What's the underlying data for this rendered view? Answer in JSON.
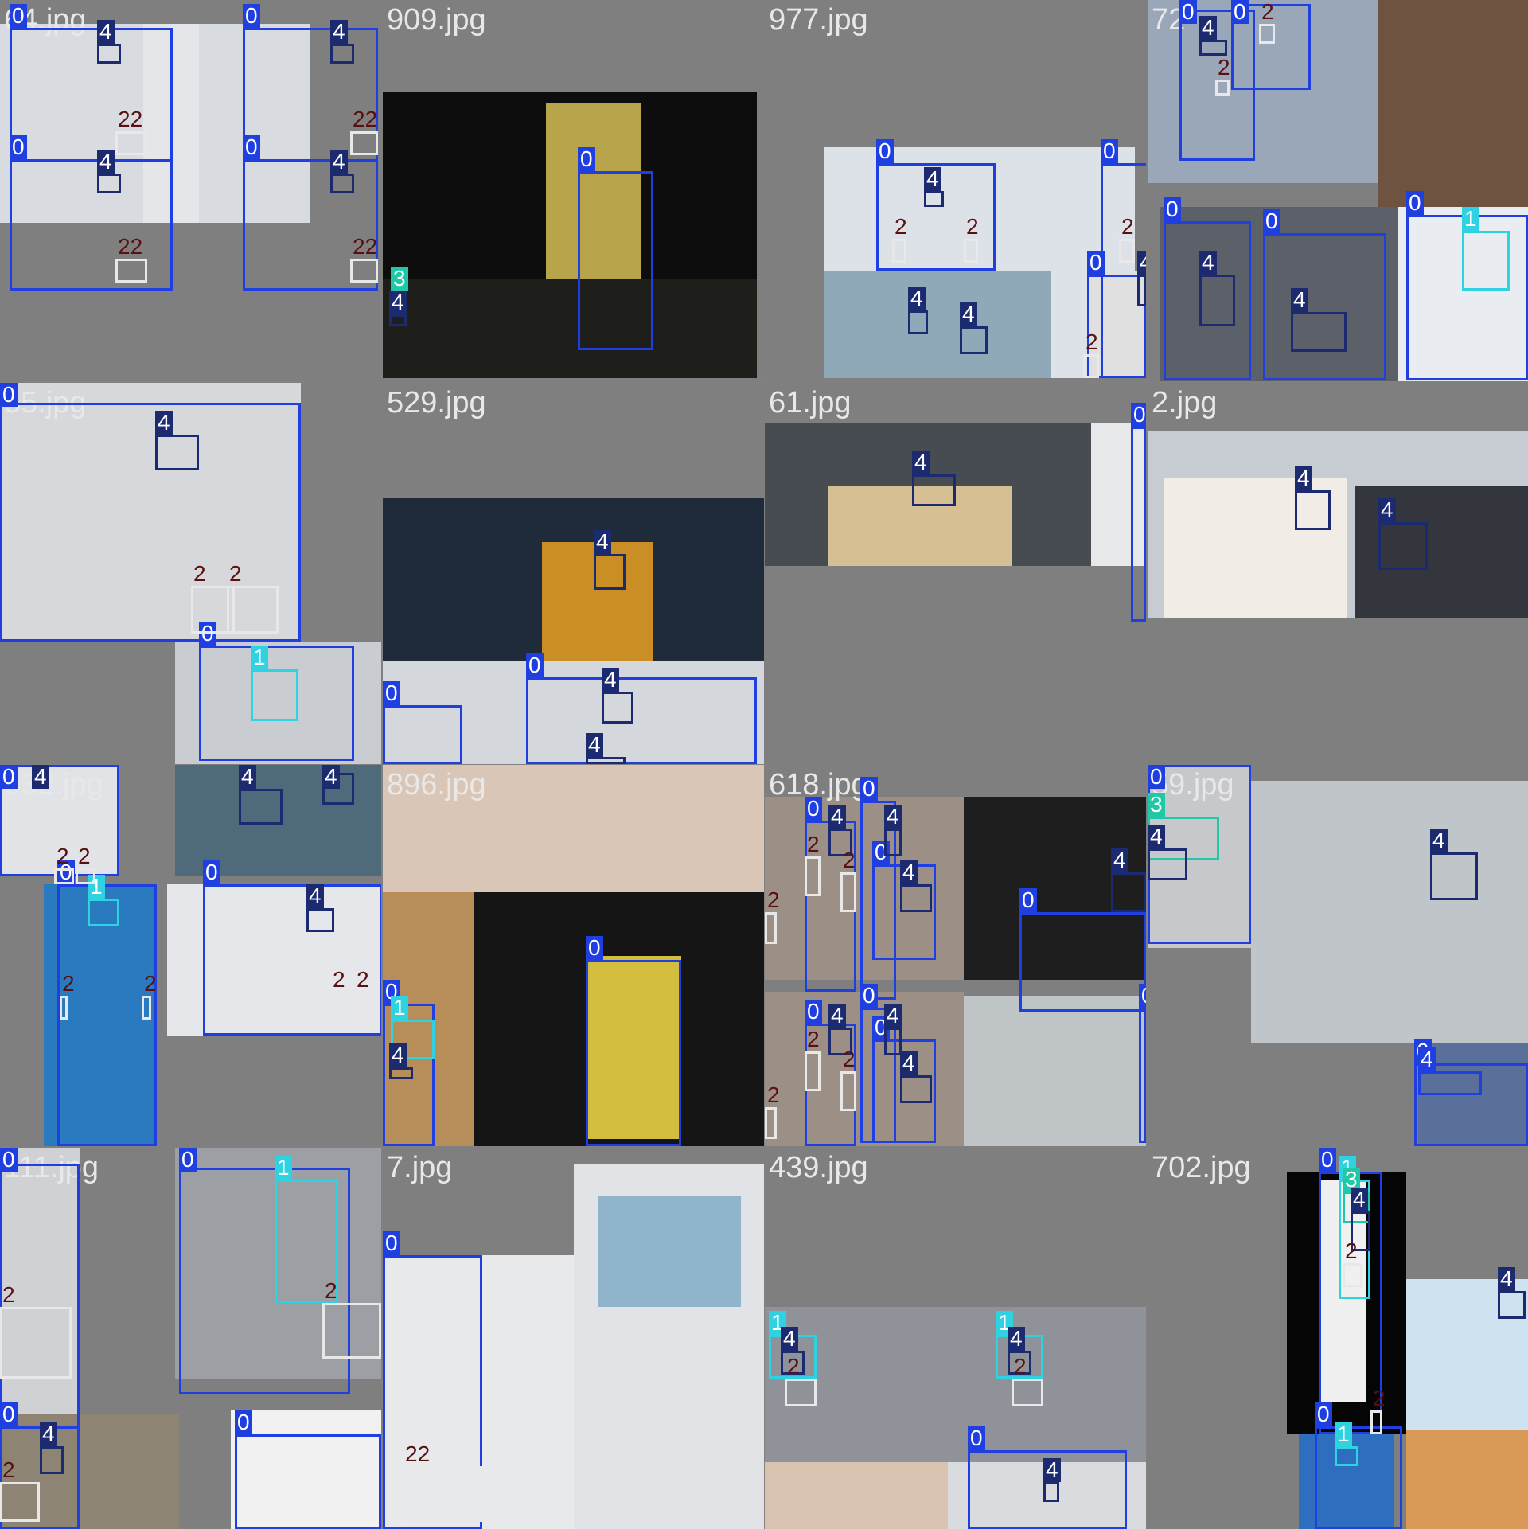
{
  "colors": {
    "class_0": "#1f3fe0",
    "class_1": "#2fd2e0",
    "class_2": "#e8e8e8",
    "class_3": "#20c8a8",
    "class_4": "#1c2a70",
    "label_2_text": "#5a1010"
  },
  "tiles": [
    {
      "filename": "64.jpg",
      "labels": [
        "0",
        "0",
        "0",
        "0",
        "4",
        "4",
        "4",
        "4",
        "22",
        "22",
        "22",
        "22"
      ]
    },
    {
      "filename": "909.jpg",
      "labels": [
        "0",
        "3",
        "4"
      ]
    },
    {
      "filename": "977.jpg",
      "labels": [
        "0",
        "0",
        "0",
        "4",
        "4",
        "4",
        "4",
        "2",
        "2",
        "2",
        "2"
      ]
    },
    {
      "filename": "72",
      "labels": [
        "0",
        "0",
        "0",
        "0",
        "0",
        "1",
        "4",
        "4",
        "4",
        "2",
        "2"
      ]
    },
    {
      "filename": "55.jpg",
      "labels": [
        "0",
        "0",
        "1",
        "4",
        "2",
        "2"
      ]
    },
    {
      "filename": "529.jpg",
      "labels": [
        "0",
        "0",
        "4",
        "4",
        "4"
      ]
    },
    {
      "filename": "61.jpg",
      "labels": [
        "0",
        "4"
      ]
    },
    {
      "filename": "2.jpg",
      "labels": [
        "4",
        "4"
      ]
    },
    {
      "filename": "532.jpg",
      "labels": [
        "0",
        "0",
        "0",
        "4",
        "4",
        "4",
        "4",
        "1",
        "2",
        "2",
        "2",
        "2",
        "2",
        "2"
      ]
    },
    {
      "filename": "896.jpg",
      "labels": [
        "0",
        "0",
        "1",
        "4"
      ]
    },
    {
      "filename": "618.jpg",
      "labels": [
        "0",
        "0",
        "0",
        "0",
        "0",
        "0",
        "0",
        "0",
        "4",
        "4",
        "4",
        "4",
        "4",
        "4",
        "4",
        "2",
        "2",
        "2",
        "2",
        "2",
        "2"
      ]
    },
    {
      "filename": "59.jpg",
      "labels": [
        "0",
        "0",
        "3",
        "4",
        "4",
        "4"
      ]
    },
    {
      "filename": "111.jpg",
      "labels": [
        "0",
        "0",
        "0",
        "0",
        "1",
        "4",
        "2",
        "2",
        "2"
      ]
    },
    {
      "filename": "7.jpg",
      "labels": [
        "0",
        "22"
      ]
    },
    {
      "filename": "439.jpg",
      "labels": [
        "0",
        "1",
        "1",
        "4",
        "4",
        "4",
        "2",
        "2"
      ]
    },
    {
      "filename": "702.jpg",
      "labels": [
        "0",
        "0",
        "1",
        "1",
        "3",
        "4",
        "4",
        "2",
        "2"
      ]
    }
  ]
}
